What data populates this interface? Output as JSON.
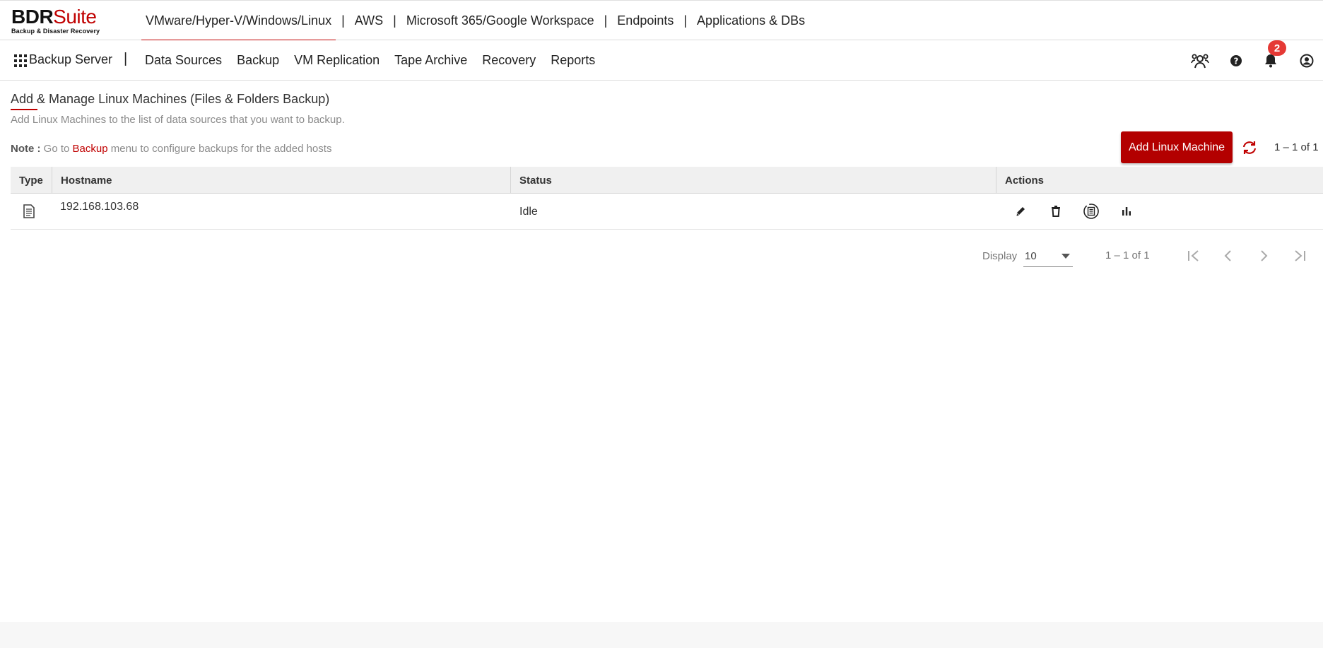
{
  "brand": {
    "name_black": "BDR",
    "name_red": "Suite",
    "tagline": "Backup & Disaster Recovery",
    "accent": "#c00000"
  },
  "top_nav": {
    "items": [
      {
        "label": "VMware/Hyper-V/Windows/Linux",
        "active": true
      },
      {
        "label": "AWS"
      },
      {
        "label": "Microsoft 365/Google Workspace"
      },
      {
        "label": "Endpoints"
      },
      {
        "label": "Applications & DBs"
      }
    ],
    "separator": "|"
  },
  "sub_nav": {
    "server_label": "Backup Server",
    "separator": "|",
    "items": [
      {
        "label": "Data Sources"
      },
      {
        "label": "Backup"
      },
      {
        "label": "VM Replication"
      },
      {
        "label": "Tape Archive"
      },
      {
        "label": "Recovery"
      },
      {
        "label": "Reports"
      }
    ],
    "notification_count": "2",
    "icons": [
      "users-icon",
      "help-icon",
      "bell-icon",
      "account-icon"
    ]
  },
  "page": {
    "title": "Add & Manage Linux Machines (Files & Folders Backup)",
    "description": "Add Linux Machines to the list of data sources that you want to backup.",
    "note_label": "Note :",
    "note_prefix": " Go to ",
    "note_link": "Backup",
    "note_suffix": " menu to configure backups for the added hosts",
    "add_button": "Add Linux Machine",
    "count_top": "1 – 1 of 1"
  },
  "table": {
    "columns": [
      "Type",
      "Hostname",
      "Status",
      "Actions"
    ],
    "rows": [
      {
        "type_icon": "file-icon",
        "hostname": "192.168.103.68",
        "status": "Idle",
        "actions": [
          "edit-icon",
          "delete-icon",
          "backup-now-icon",
          "report-icon"
        ]
      }
    ]
  },
  "pagination": {
    "display_label": "Display",
    "page_size": "10",
    "count": "1 – 1 of 1"
  }
}
